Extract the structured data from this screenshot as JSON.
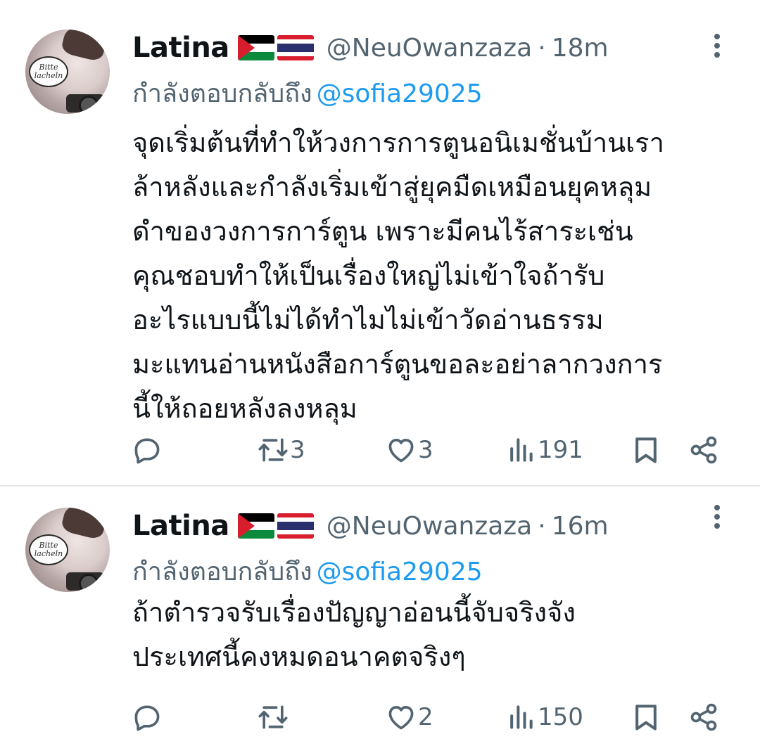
{
  "tweets": [
    {
      "name": "Latina",
      "flags": [
        "palestine-flag",
        "thailand-flag"
      ],
      "handle": "@NeuOwanzaza",
      "separator": "·",
      "time": "18m",
      "reply_prefix": "กำลังตอบกลับถึง",
      "reply_to": "@sofia29025",
      "lines": [
        "จุดเริ่มต้นที่ทำให้วงการการตูนอนิเมชั่นบ้านเรา",
        "ล้าหลังและกำลังเริ่มเข้าสู่ยุคมืดเหมือนยุคหลุม",
        "ดำของวงการการ์ตูน เพราะมีคนไร้สาระเช่น",
        "คุณชอบทำให้เป็นเรื่องใหญ่ไม่เข้าใจถ้ารับ",
        "อะไรแบบนี้ไม่ได้ทำไมไม่เข้าวัดอ่านธรรม",
        "มะแทนอ่านหนังสือการ์ตูนขอละอย่าลากวงการ",
        "นี้ให้ถอยหลังลงหลุม"
      ],
      "stats": {
        "replies": "",
        "retweets": "3",
        "likes": "3",
        "views": "191"
      }
    },
    {
      "name": "Latina",
      "flags": [
        "palestine-flag",
        "thailand-flag"
      ],
      "handle": "@NeuOwanzaza",
      "separator": "·",
      "time": "16m",
      "reply_prefix": "กำลังตอบกลับถึง",
      "reply_to": "@sofia29025",
      "lines": [
        "ถ้าตำรวจรับเรื่องปัญญาอ่อนนี้จับจริงจัง",
        "ประเทศนี้คงหมดอนาคตจริงๆ"
      ],
      "stats": {
        "replies": "",
        "retweets": "",
        "likes": "2",
        "views": "150"
      }
    }
  ],
  "avatar_text": "Bitte lacheln",
  "colors": {
    "text": "#0f1419",
    "muted": "#536471",
    "link": "#1d9bf0",
    "divider": "#e6e9eb"
  }
}
